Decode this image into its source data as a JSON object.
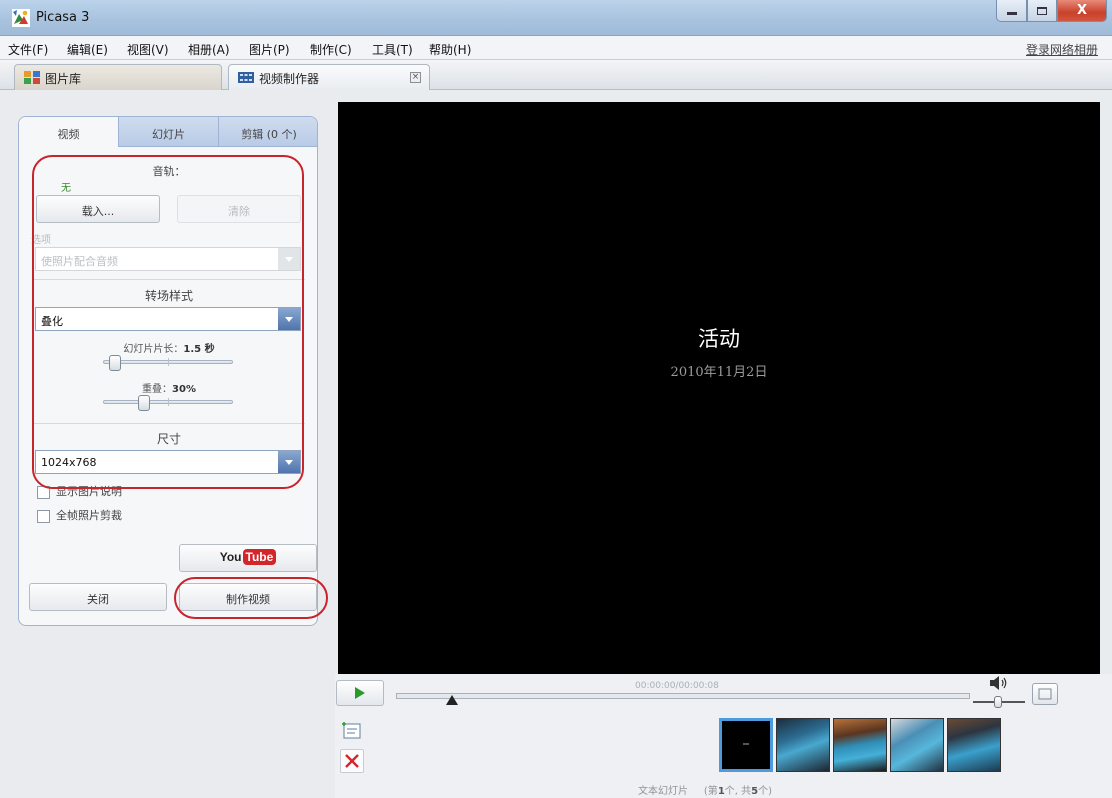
{
  "window": {
    "title": "Picasa 3",
    "close_glyph": "X"
  },
  "menu": {
    "items": [
      "文件(F)",
      "编辑(E)",
      "视图(V)",
      "相册(A)",
      "图片(P)",
      "制作(C)",
      "工具(T)",
      "帮助(H)"
    ],
    "login_link": "登录网络相册"
  },
  "tabs": {
    "library": "图片库",
    "movie_maker": "视频制作器",
    "close_glyph": "×"
  },
  "panel": {
    "tabs": {
      "video": "视频",
      "slides": "幻灯片",
      "clips": "剪辑 (0 个)"
    },
    "audio": {
      "title": "音轨：",
      "value": "无",
      "load_button": "载入...",
      "clear_button": "清除",
      "options_label": "选项",
      "options_value": "使照片配合音频"
    },
    "transition": {
      "title": "转场样式",
      "value": "叠化",
      "duration_label": "幻灯片片长：",
      "duration_value": "1.5 秒",
      "duration_fraction": 0.05,
      "overlap_label": "重叠：",
      "overlap_value": "30%",
      "overlap_fraction": 0.3
    },
    "dimensions": {
      "title": "尺寸",
      "value": "1024x768"
    },
    "checkboxes": {
      "show_captions": "显示图片说明",
      "full_frame_crop": "全帧照片剪裁"
    },
    "youtube": {
      "you": "You",
      "tube": "Tube"
    },
    "close_button": "关闭",
    "make_movie_button": "制作视频"
  },
  "preview": {
    "title": "活动",
    "date": "2010年11月2日"
  },
  "player": {
    "time_code": "00:00:00/00:00:08",
    "strip_label": "文本幻灯片",
    "strip_open": "(第",
    "strip_current": "1",
    "strip_mid": "个, 共",
    "strip_total": "5",
    "strip_close": "个)",
    "add_text_icon": "text-slide-icon",
    "delete_icon": "delete-icon"
  },
  "colors": {
    "accent": "#4f74ad",
    "highlight": "#c7242b",
    "preview_bg": "#000000"
  }
}
